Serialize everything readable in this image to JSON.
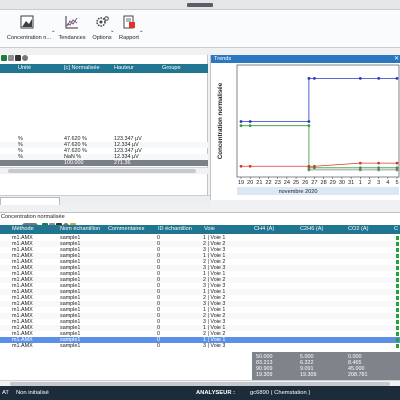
{
  "ribbon": {
    "concentration_label": "Concentration n...",
    "tendances_label": "Tendances",
    "options_label": "Options",
    "rapport_label": "Rapport"
  },
  "top_table": {
    "columns": [
      "Unité",
      "[c] Normalisée",
      "Hauteur",
      "Groupe"
    ],
    "rows": [
      {
        "unite": "%",
        "norm": "47.620 %",
        "hauteur": "123.347 µV",
        "groupe": ""
      },
      {
        "unite": "%",
        "norm": "47.620 %",
        "hauteur": "12.334 µV",
        "groupe": ""
      },
      {
        "unite": "%",
        "norm": "47.620 %",
        "hauteur": "123.347 µV",
        "groupe": ""
      },
      {
        "unite": "%",
        "norm": "NaN %",
        "hauteur": "12.334 µV",
        "groupe": ""
      }
    ],
    "total": {
      "norm": "100.000",
      "hauteur": "271.36"
    }
  },
  "trends": {
    "title": "Trends",
    "ylabel": "Concentration normalisée",
    "xticks": [
      "19",
      "20",
      "21",
      "22",
      "23",
      "24",
      "25",
      "26",
      "27",
      "28",
      "29",
      "30",
      "31",
      "1",
      "2",
      "3",
      "4",
      "5"
    ],
    "month": "novembre 2020"
  },
  "chart_data": {
    "type": "line",
    "title": "Trends",
    "ylabel": "Concentration normalisée",
    "xlabel": "novembre 2020",
    "categories": [
      "19",
      "20",
      "21",
      "22",
      "23",
      "24",
      "25",
      "26",
      "27",
      "28",
      "29",
      "30",
      "31",
      "1",
      "2",
      "3",
      "4",
      "5"
    ],
    "series": [
      {
        "color": "#2a35c9",
        "points": [
          [
            0,
            49.5
          ],
          [
            1,
            49.5
          ],
          [
            7.4,
            49.5
          ],
          [
            7.4,
            91
          ],
          [
            8,
            91
          ],
          [
            13,
            91
          ],
          [
            15,
            91
          ],
          [
            17,
            91
          ]
        ]
      },
      {
        "color": "#2b9c37",
        "points": [
          [
            0,
            45.5
          ],
          [
            1,
            45.5
          ],
          [
            7.4,
            45.5
          ],
          [
            7.4,
            5
          ],
          [
            8,
            5
          ],
          [
            13,
            5
          ],
          [
            15,
            5
          ],
          [
            17,
            5
          ]
        ]
      },
      {
        "color": "#d63b2f",
        "points": [
          [
            0,
            6.5
          ],
          [
            1,
            6.5
          ],
          [
            7.4,
            6.5
          ],
          [
            8,
            6.5
          ],
          [
            13,
            9.5
          ],
          [
            15,
            9.5
          ],
          [
            17,
            9.5
          ]
        ]
      },
      {
        "color": "#7a7a7a",
        "points": [
          [
            7.4,
            3
          ],
          [
            13,
            3
          ],
          [
            15,
            3
          ],
          [
            17,
            3
          ]
        ]
      }
    ],
    "grid": false
  },
  "lower": {
    "title": "Concentration normalisée",
    "columns": [
      "Méthode",
      "Nom échantillon",
      "Commentaires",
      "ID échantillon",
      "Voie",
      "CH4 (A)",
      "C2H6 (A)",
      "CO2 (A)",
      "C"
    ],
    "rows": [
      {
        "methode": "m1.AMX",
        "nom": "sample1",
        "id": "0",
        "voie": "1 | Voie 1"
      },
      {
        "methode": "m1.AMX",
        "nom": "sample1",
        "id": "0",
        "voie": "2 | Voie 2"
      },
      {
        "methode": "m1.AMX",
        "nom": "sample1",
        "id": "0",
        "voie": "3 | Voie 3"
      },
      {
        "methode": "m1.AMX",
        "nom": "sample1",
        "id": "0",
        "voie": "1 | Voie 1"
      },
      {
        "methode": "m1.AMX",
        "nom": "sample1",
        "id": "0",
        "voie": "2 | Voie 2"
      },
      {
        "methode": "m1.AMX",
        "nom": "sample1",
        "id": "0",
        "voie": "3 | Voie 3"
      },
      {
        "methode": "m1.AMX",
        "nom": "sample1",
        "id": "0",
        "voie": "1 | Voie 1"
      },
      {
        "methode": "m1.AMX",
        "nom": "sample1",
        "id": "0",
        "voie": "2 | Voie 2"
      },
      {
        "methode": "m1.AMX",
        "nom": "sample1",
        "id": "0",
        "voie": "3 | Voie 3"
      },
      {
        "methode": "m1.AMX",
        "nom": "sample1",
        "id": "0",
        "voie": "1 | Voie 1"
      },
      {
        "methode": "m1.AMX",
        "nom": "sample1",
        "id": "0",
        "voie": "2 | Voie 2"
      },
      {
        "methode": "m1.AMX",
        "nom": "sample1",
        "id": "0",
        "voie": "3 | Voie 3"
      },
      {
        "methode": "m1.AMX",
        "nom": "sample1",
        "id": "0",
        "voie": "1 | Voie 1"
      },
      {
        "methode": "m1.AMX",
        "nom": "sample1",
        "id": "0",
        "voie": "2 | Voie 2"
      },
      {
        "methode": "m1.AMX",
        "nom": "sample1",
        "id": "0",
        "voie": "3 | Voie 3"
      },
      {
        "methode": "m1.AMX",
        "nom": "sample1",
        "id": "0",
        "voie": "1 | Voie 1"
      },
      {
        "methode": "m1.AMX",
        "nom": "sample1",
        "id": "0",
        "voie": "2 | Voie 2"
      },
      {
        "methode": "m1.AMX",
        "nom": "sample1",
        "id": "0",
        "voie": "1 | Voie 1"
      },
      {
        "methode": "m1.AMX",
        "nom": "sample1",
        "id": "0",
        "voie": "3 | Voie 3"
      }
    ],
    "selected_row": 17,
    "stats": [
      [
        "50.000",
        "5.000",
        "0.000"
      ],
      [
        "83.213",
        "6.322",
        "8.465"
      ],
      [
        "90.909",
        "9.091",
        "45.000"
      ],
      [
        "19.309",
        "19.309",
        "208.781"
      ]
    ]
  },
  "status": {
    "mode": "AT",
    "state": "Non initialisé",
    "analyser_label": "ANALYSEUR :",
    "analyser_value": "gc6890 ( Chemstation )"
  }
}
